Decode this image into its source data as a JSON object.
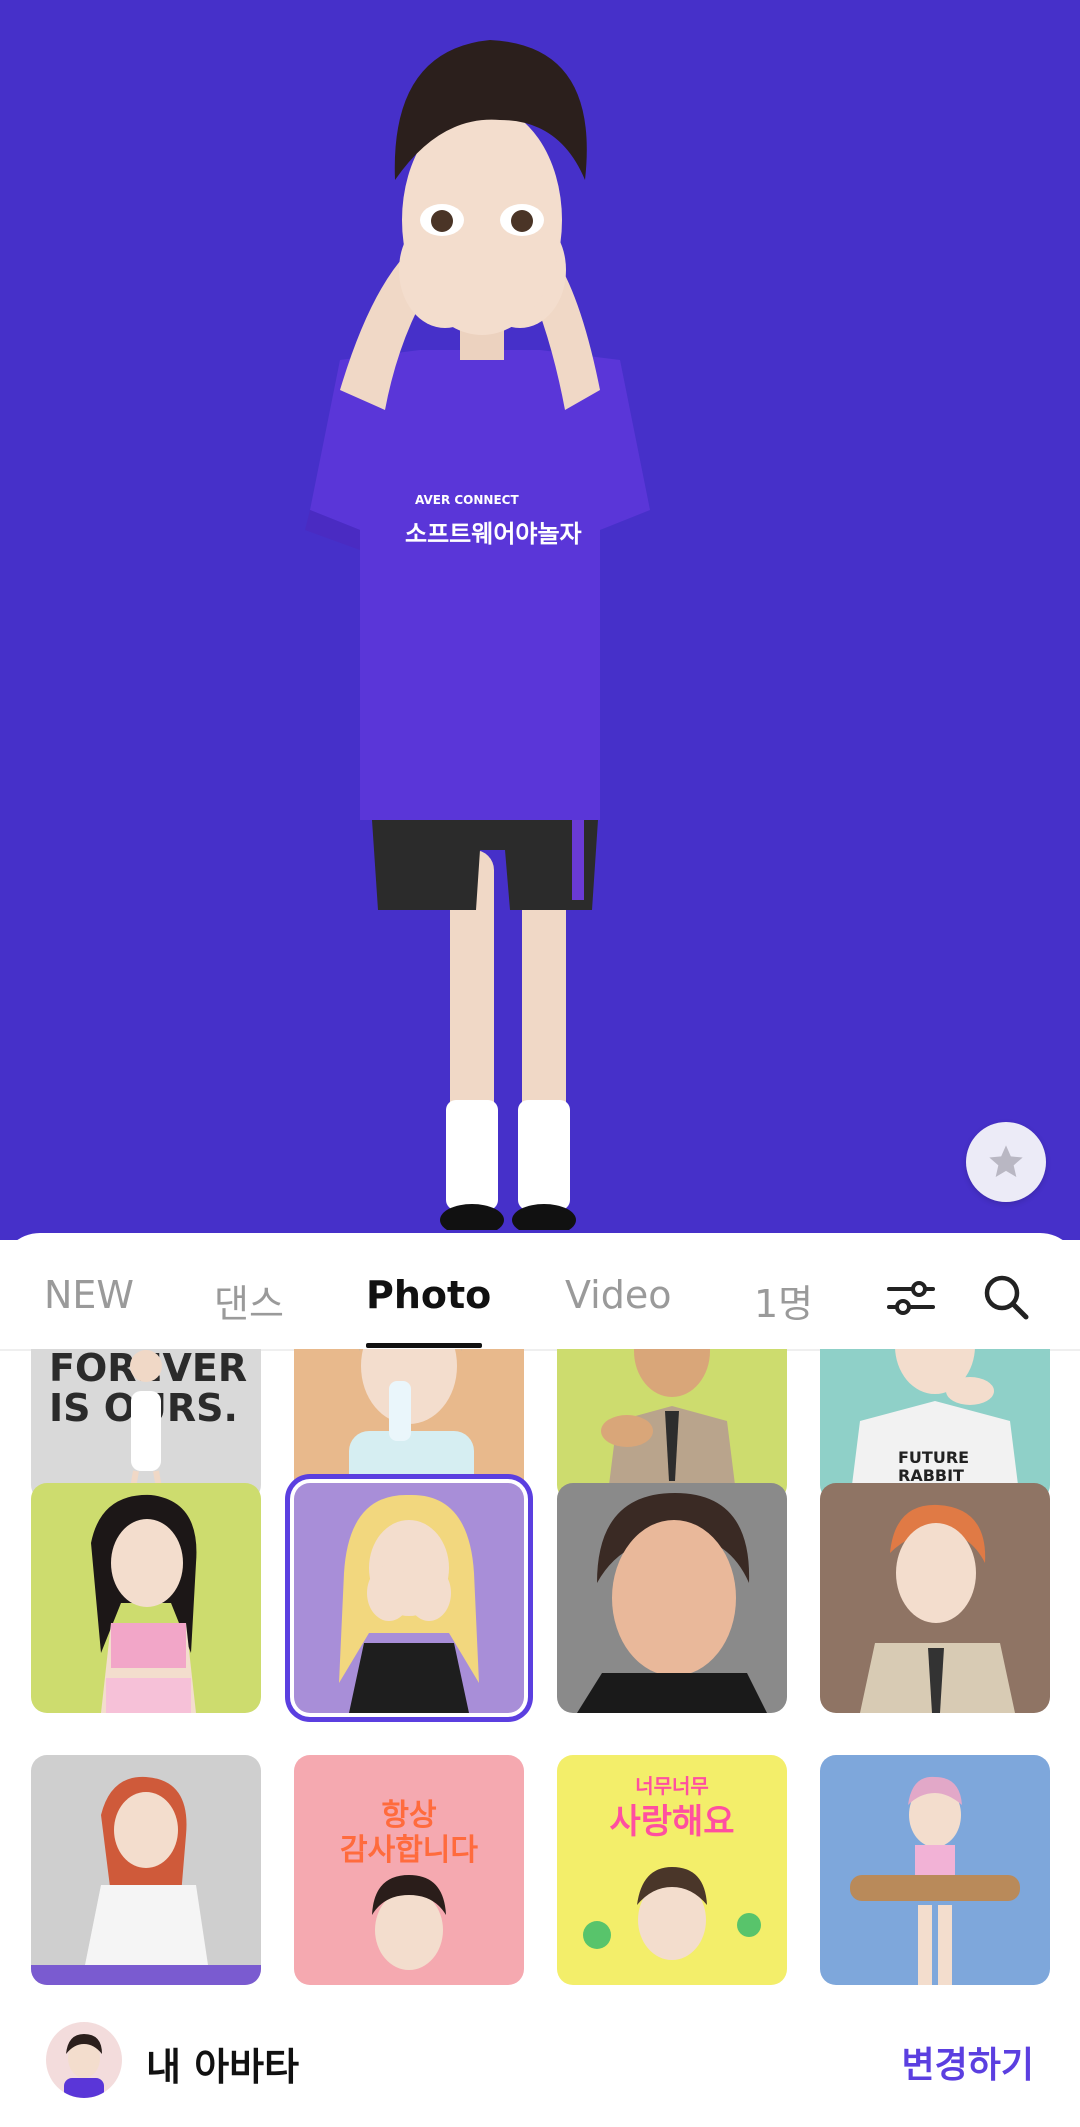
{
  "preview": {
    "background": "#4630c9",
    "shirt_text_top": "AVER CONNECT",
    "shirt_text_main": "소프트웨어야놀자"
  },
  "tabs": [
    {
      "label": "NEW"
    },
    {
      "label": "댄스"
    },
    {
      "label": "Photo",
      "active": true
    },
    {
      "label": "Video"
    },
    {
      "label": "1명"
    }
  ],
  "icons": {
    "filter": "filter-sliders-icon",
    "search": "search-icon",
    "favorite": "star-icon"
  },
  "grid": {
    "row1": [
      {
        "bg": "#d9d9d9",
        "text": "FOREVER IS OURS."
      },
      {
        "bg": "#e8b98c"
      },
      {
        "bg": "#cddc6e"
      },
      {
        "bg": "#8fd0c8",
        "text": "FUTURE RABBIT TURTLE RUN."
      }
    ],
    "row2": [
      {
        "bg": "#cddc6e"
      },
      {
        "bg": "#a88ed8",
        "selected": true
      },
      {
        "bg": "#8a8a8a"
      },
      {
        "bg": "#8f7464"
      }
    ],
    "row3": [
      {
        "bg": "#cfcfcf"
      },
      {
        "bg": "#f5a9b0",
        "text": "항상 감사합니다"
      },
      {
        "bg": "#f3ee6a",
        "text": "너무너무 사랑해요"
      },
      {
        "bg": "#7ea7db"
      }
    ]
  },
  "footer": {
    "label": "내 아바타",
    "change": "변경하기"
  },
  "accent": "#5b3fe0"
}
